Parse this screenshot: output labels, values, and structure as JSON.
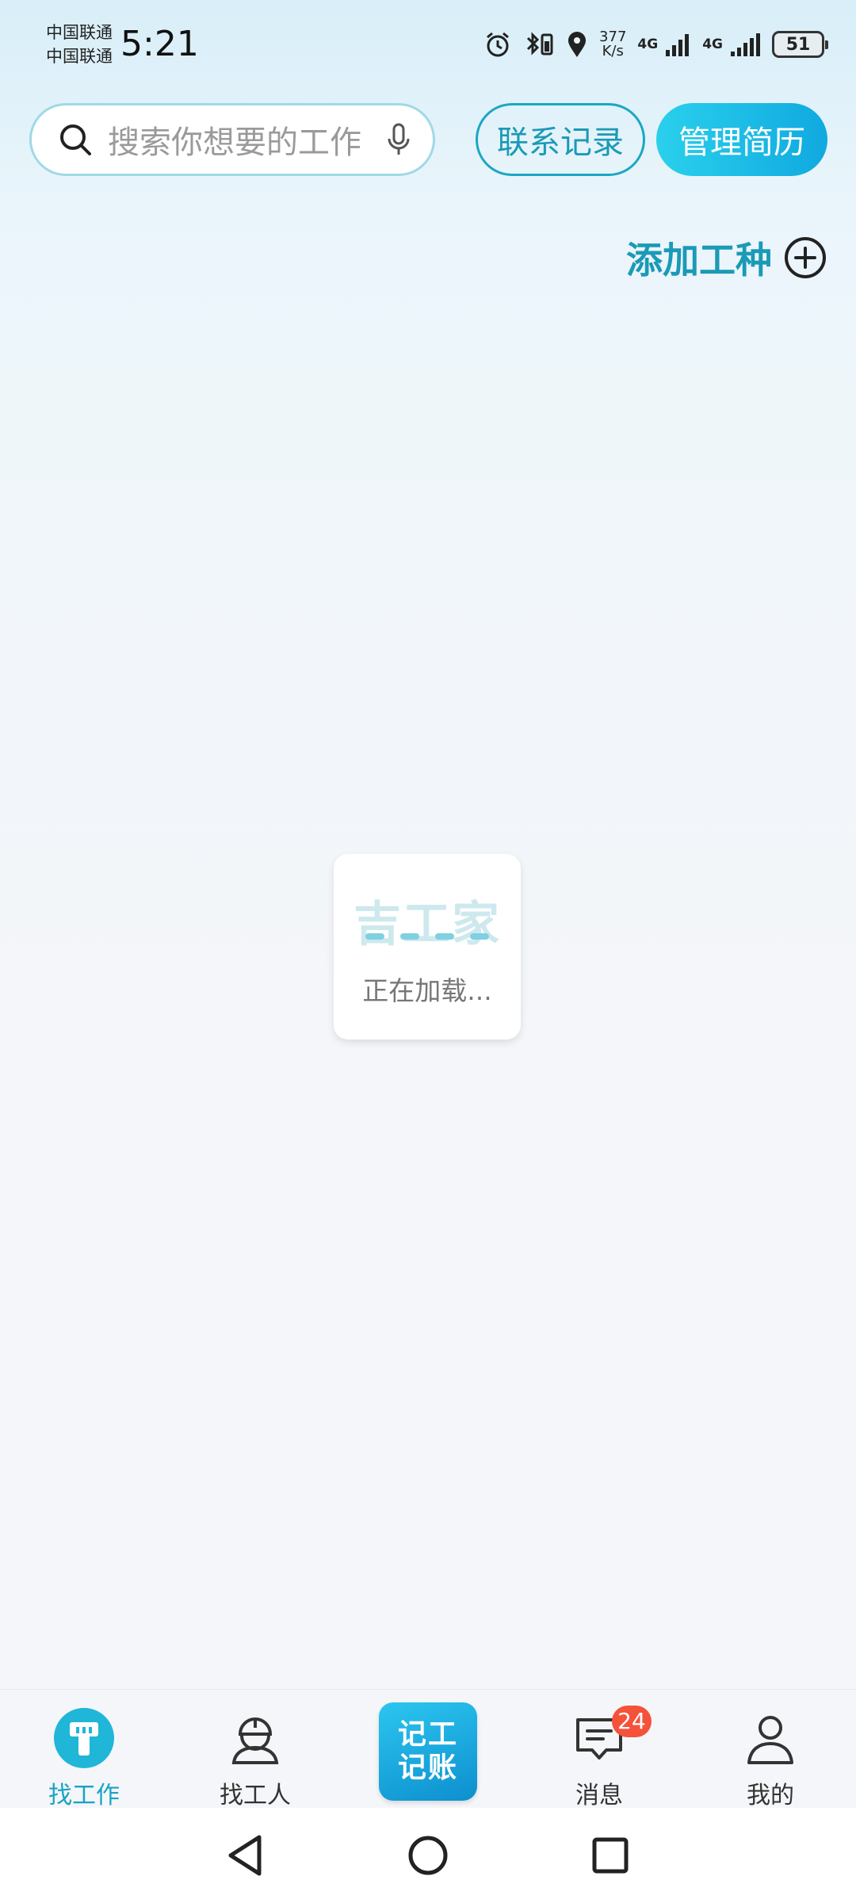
{
  "status_bar": {
    "carrier1": "中国联通",
    "carrier2": "中国联通",
    "time": "5:21",
    "net_speed_value": "377",
    "net_speed_unit": "K/s",
    "net_type1": "4G",
    "net_type2": "4G",
    "battery": "51"
  },
  "header": {
    "search_placeholder": "搜索你想要的工作",
    "contact_records": "联系记录",
    "manage_resume": "管理简历"
  },
  "add_trade": {
    "label": "添加工种"
  },
  "loading": {
    "logo_text": "吉工家",
    "text": "正在加载..."
  },
  "bottom_nav": {
    "items": [
      {
        "label": "找工作",
        "icon": "find-job-icon",
        "active": true
      },
      {
        "label": "找工人",
        "icon": "worker-helmet-icon"
      },
      {
        "label_line1": "记工",
        "label_line2": "记账",
        "icon": "record-work-button"
      },
      {
        "label": "消息",
        "icon": "message-icon",
        "badge": "24"
      },
      {
        "label": "我的",
        "icon": "profile-icon"
      }
    ]
  },
  "colors": {
    "accent": "#18a3c4",
    "badge": "#f5523a"
  }
}
